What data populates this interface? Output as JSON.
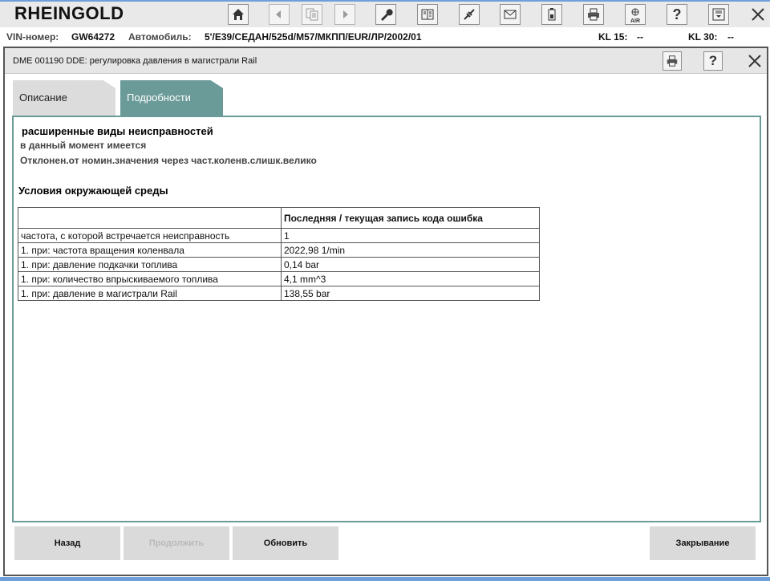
{
  "app": {
    "title": "RHEINGOLD"
  },
  "toolbar": {
    "icons": [
      "home-icon",
      "back-icon",
      "documents-icon",
      "forward-icon",
      "wrench-icon",
      "vehicle-info-icon",
      "connection-icon",
      "mail-icon",
      "battery-icon",
      "print-icon",
      "air-icon",
      "help-icon",
      "download-icon",
      "close-icon"
    ],
    "air_label": "AIR",
    "help_label": "?"
  },
  "info": {
    "vin_label": "VIN-номер:",
    "vin_value": "GW64272",
    "car_label": "Автомобиль:",
    "car_value": "5'/E39/СЕДАН/525d/M57/МКПП/EUR/ЛР/2002/01",
    "kl15_label": "KL 15:",
    "kl15_value": "--",
    "kl30_label": "KL 30:",
    "kl30_value": "--"
  },
  "dialog": {
    "title": "DME 001190 DDE: регулировка давления в магистрали Rail",
    "help_label": "?"
  },
  "tabs": [
    {
      "label": "Описание",
      "active": false
    },
    {
      "label": "Подробности",
      "active": true
    }
  ],
  "details": {
    "extended_heading": "расширенные виды неисправностей",
    "status": "в данный момент имеется",
    "description": "Отклонен.от номин.значения через част.коленв.слишк.велико",
    "env_heading": "Условия окружающей среды",
    "table": {
      "headers": [
        "",
        "Последняя / текущая запись кода ошибка"
      ],
      "rows": [
        [
          "частота, с которой встречается неисправность",
          "1"
        ],
        [
          "1. при: частота вращения коленвала",
          "2022,98 1/min"
        ],
        [
          "1. при: давление подкачки топлива",
          "0,14 bar"
        ],
        [
          "1. при: количество впрыскиваемого топлива",
          "4,1 mm^3"
        ],
        [
          "1. при: давление в магистрали Rail",
          "138,55 bar"
        ]
      ]
    }
  },
  "footer": {
    "back_label": "Назад",
    "continue_label": "Продолжить",
    "refresh_label": "Обновить",
    "close_label": "Закрывание"
  },
  "colors": {
    "accent": "#6b9b98",
    "frame_blue": "#6f9fd8"
  }
}
